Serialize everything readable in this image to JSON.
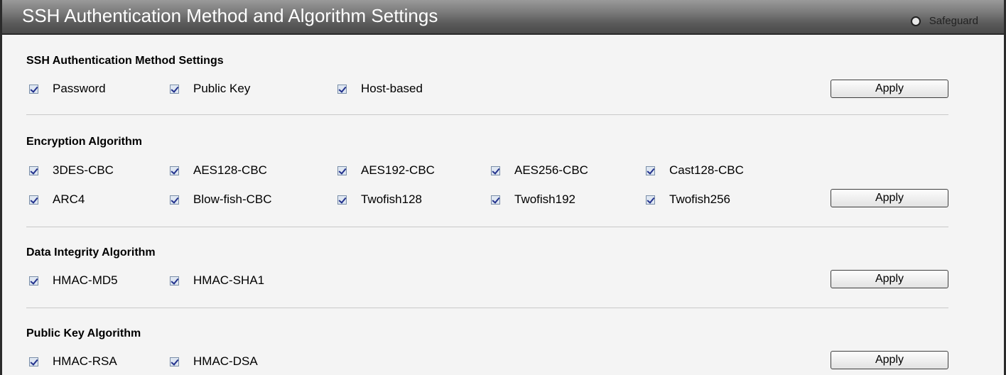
{
  "window": {
    "title": "SSH Authentication Method and Algorithm Settings",
    "safeguard_label": "Safeguard"
  },
  "auth": {
    "heading": "SSH Authentication Method Settings",
    "items": [
      {
        "label": "Password",
        "checked": true
      },
      {
        "label": "Public Key",
        "checked": true
      },
      {
        "label": "Host-based",
        "checked": true
      }
    ],
    "apply_label": "Apply"
  },
  "encryption": {
    "heading": "Encryption Algorithm",
    "items": [
      {
        "label": "3DES-CBC",
        "checked": true
      },
      {
        "label": "AES128-CBC",
        "checked": true
      },
      {
        "label": "AES192-CBC",
        "checked": true
      },
      {
        "label": "AES256-CBC",
        "checked": true
      },
      {
        "label": "Cast128-CBC",
        "checked": true
      },
      {
        "label": "ARC4",
        "checked": true
      },
      {
        "label": "Blow-fish-CBC",
        "checked": true
      },
      {
        "label": "Twofish128",
        "checked": true
      },
      {
        "label": "Twofish192",
        "checked": true
      },
      {
        "label": "Twofish256",
        "checked": true
      }
    ],
    "apply_label": "Apply"
  },
  "integrity": {
    "heading": "Data Integrity Algorithm",
    "items": [
      {
        "label": "HMAC-MD5",
        "checked": true
      },
      {
        "label": "HMAC-SHA1",
        "checked": true
      }
    ],
    "apply_label": "Apply"
  },
  "publickey": {
    "heading": "Public Key Algorithm",
    "items": [
      {
        "label": "HMAC-RSA",
        "checked": true
      },
      {
        "label": "HMAC-DSA",
        "checked": true
      }
    ],
    "apply_label": "Apply"
  }
}
